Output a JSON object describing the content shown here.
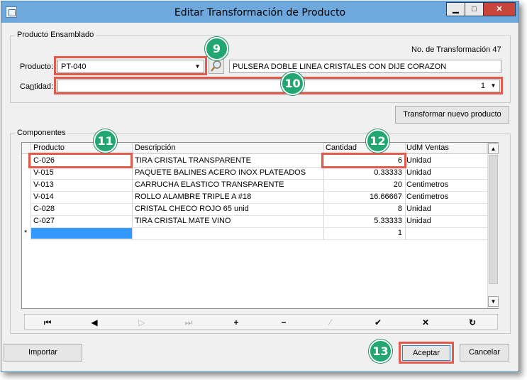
{
  "window": {
    "title": "Editar Transformación de Producto",
    "controls": {
      "minimize": "▁",
      "maximize": "□",
      "close": "✕"
    }
  },
  "assembled": {
    "legend": "Producto Ensamblado",
    "transform_label": "No. de Transformación",
    "transform_number": "47",
    "product_label": "Producto:",
    "product_value": "PT-040",
    "product_description": "PULSERA DOBLE LINEA CRISTALES CON DIJE CORAZON",
    "quantity_label_pre": "Ca",
    "quantity_label_u": "n",
    "quantity_label_post": "tidad:",
    "quantity_value": "1"
  },
  "buttons": {
    "transform_new": "Transformar nuevo producto",
    "import": "Importar",
    "accept": "Aceptar",
    "cancel": "Cancelar"
  },
  "components": {
    "legend": "Componentes",
    "columns": {
      "product": "Producto",
      "description": "Descripción",
      "quantity": "Cantidad",
      "unit": "UdM Ventas"
    },
    "rows": [
      {
        "product": "C-026",
        "description": "TIRA CRISTAL TRANSPARENTE",
        "quantity": "6",
        "unit": "Unidad"
      },
      {
        "product": "V-015",
        "description": "PAQUETE BALINES ACERO INOX PLATEADOS",
        "quantity": "0.33333",
        "unit": "Unidad"
      },
      {
        "product": "V-013",
        "description": "CARRUCHA ELASTICO TRANSPARENTE",
        "quantity": "20",
        "unit": "Centimetros"
      },
      {
        "product": "V-014",
        "description": "ROLLO ALAMBRE TRIPLE A #18",
        "quantity": "16.66667",
        "unit": "Centimetros"
      },
      {
        "product": "C-028",
        "description": "CRISTAL CHECO ROJO 65 unid",
        "quantity": "8",
        "unit": "Unidad"
      },
      {
        "product": "C-027",
        "description": "TIRA CRISTAL MATE VINO",
        "quantity": "5.33333",
        "unit": "Unidad"
      }
    ],
    "new_row_marker": "*",
    "new_row_quantity": "1"
  },
  "navigator": {
    "first": "⏮",
    "prior": "◀",
    "next": "▷",
    "last": "⏭",
    "insert": "+",
    "delete": "−",
    "edit": "⁄",
    "post": "✔",
    "cancel": "✕",
    "refresh": "↻"
  },
  "callouts": {
    "c9": "9",
    "c10": "10",
    "c11": "11",
    "c12": "12",
    "c13": "13"
  },
  "colors": {
    "highlight": "#e05a4e",
    "badge": "#23a772",
    "titlebar": "#6fa8dc",
    "selected_cell": "#3399ff"
  }
}
